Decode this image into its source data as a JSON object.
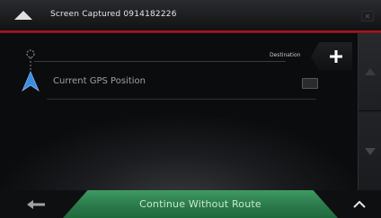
{
  "header": {
    "title": "Screen Captured 0914182226",
    "notification_icon": "up-arrow-icon",
    "close_icon": "close-icon"
  },
  "route": {
    "destination_label": "Destination",
    "add_destination_icon": "plus-icon",
    "start_label": "Current GPS Position",
    "start_icon": "gps-arrow-icon"
  },
  "scroll": {
    "up_icon": "chevron-up-icon",
    "down_icon": "chevron-down-icon"
  },
  "bottom_bar": {
    "back_icon": "back-arrow-icon",
    "continue_label": "Continue Without Route",
    "expand_icon": "chevron-up-icon"
  },
  "colors": {
    "accent_red": "#b8192a",
    "continue_green": "#2b7a4a",
    "gps_blue": "#3b8de0"
  }
}
